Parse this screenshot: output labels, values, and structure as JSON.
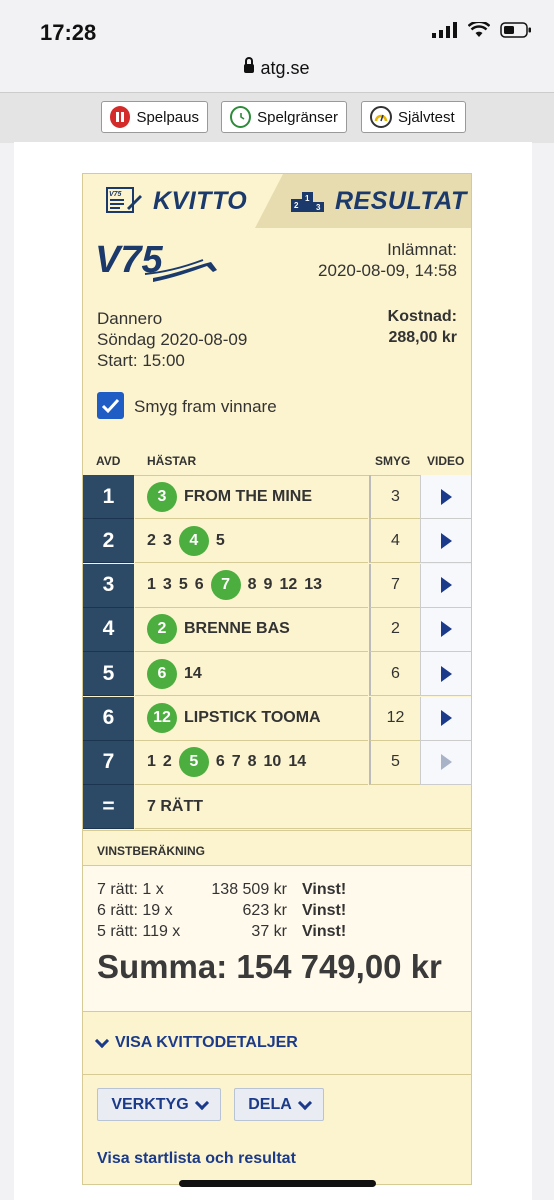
{
  "status": {
    "time": "17:28"
  },
  "browser": {
    "url": "atg.se"
  },
  "toolbar": {
    "spelpaus": "Spelpaus",
    "spelgranser": "Spelgränser",
    "sjalvtest": "Självtest"
  },
  "tabs": {
    "kvitto": "KVITTO",
    "resultat": "RESULTAT"
  },
  "receipt": {
    "game": "V75",
    "submitted_label": "Inlämnat:",
    "submitted_value": "2020-08-09, 14:58",
    "track": "Dannero",
    "date": "Söndag 2020-08-09",
    "start": "Start: 15:00",
    "cost_label": "Kostnad:",
    "cost_value": "288,00 kr",
    "checkbox_label": "Smyg fram vinnare",
    "checkbox_checked": true
  },
  "table": {
    "headers": {
      "avd": "AVD",
      "hastar": "HÄSTAR",
      "smyg": "SMYG",
      "video": "VIDEO"
    },
    "rows": [
      {
        "avd": "1",
        "picks": [
          "3"
        ],
        "winner": "3",
        "name": "FROM THE MINE",
        "smyg": "3",
        "video_enabled": true
      },
      {
        "avd": "2",
        "picks": [
          "2",
          "3",
          "4",
          "5"
        ],
        "winner": "4",
        "name": "",
        "smyg": "4",
        "video_enabled": true
      },
      {
        "avd": "3",
        "picks": [
          "1",
          "3",
          "5",
          "6",
          "7",
          "8",
          "9",
          "12",
          "13"
        ],
        "winner": "7",
        "name": "",
        "smyg": "7",
        "video_enabled": true
      },
      {
        "avd": "4",
        "picks": [
          "2"
        ],
        "winner": "2",
        "name": "BRENNE BAS",
        "smyg": "2",
        "video_enabled": true
      },
      {
        "avd": "5",
        "picks": [
          "6",
          "14"
        ],
        "winner": "6",
        "name": "",
        "smyg": "6",
        "video_enabled": true
      },
      {
        "avd": "6",
        "picks": [
          "12"
        ],
        "winner": "12",
        "name": "LIPSTICK TOOMA",
        "smyg": "12",
        "video_enabled": true
      },
      {
        "avd": "7",
        "picks": [
          "1",
          "2",
          "5",
          "6",
          "7",
          "8",
          "10",
          "14"
        ],
        "winner": "5",
        "name": "",
        "smyg": "5",
        "video_enabled": false
      }
    ],
    "sum": {
      "symbol": "=",
      "text": "7 RÄTT"
    }
  },
  "winnings": {
    "header": "VINSTBERÄKNING",
    "lines": [
      {
        "count": "7 rätt: 1 x",
        "amount": "138 509 kr",
        "status": "Vinst!"
      },
      {
        "count": "6 rätt: 19 x",
        "amount": "623 kr",
        "status": "Vinst!"
      },
      {
        "count": "5 rätt: 119 x",
        "amount": "37 kr",
        "status": "Vinst!"
      }
    ],
    "total": "Summa: 154 749,00 kr"
  },
  "actions": {
    "details": "VISA KVITTODETALJER",
    "tools": "VERKTYG",
    "share": "DELA",
    "startlist": "Visa startlista och resultat"
  },
  "colors": {
    "brand_blue": "#1b3a6b",
    "winner_green": "#4cae3f",
    "card_bg": "#fcf4cf",
    "avd_bg": "#2c4a66",
    "checkbox": "#1f5cc4"
  }
}
